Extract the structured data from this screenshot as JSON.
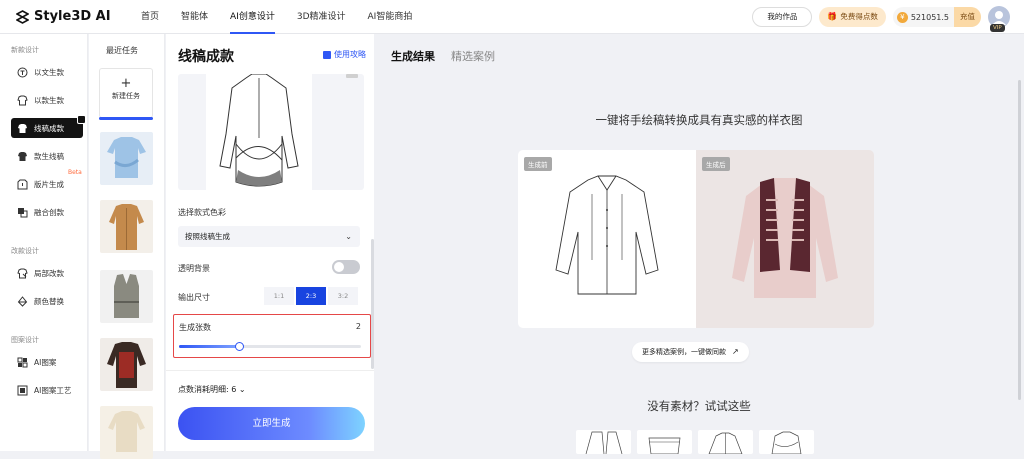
{
  "app": {
    "brand": "Style3D AI"
  },
  "nav": {
    "items": [
      "首页",
      "智能体",
      "AI创意设计",
      "3D精准设计",
      "AI智能商拍"
    ],
    "active_index": 2
  },
  "header": {
    "my_works": "我的作品",
    "free_points": "免费得点数",
    "points": "521051.5",
    "recharge": "充值",
    "vip": "VIP"
  },
  "sidebar": {
    "groups": [
      "新款设计",
      "改款设计",
      "图案设计"
    ],
    "items": [
      {
        "label": "以文生款",
        "icon": "text-shirt-icon"
      },
      {
        "label": "以款生款",
        "icon": "shirt-copy-icon"
      },
      {
        "label": "线稿成款",
        "icon": "sketch-shirt-icon",
        "active": true
      },
      {
        "label": "款生线稿",
        "icon": "shirt-to-sketch-icon"
      },
      {
        "label": "版片生成",
        "icon": "pattern-piece-icon",
        "badge": "Beta"
      },
      {
        "label": "融合创款",
        "icon": "merge-icon"
      },
      {
        "label": "局部改款",
        "icon": "partial-edit-icon"
      },
      {
        "label": "颜色替换",
        "icon": "color-replace-icon"
      },
      {
        "label": "AI图案",
        "icon": "ai-pattern-icon"
      },
      {
        "label": "AI图案工艺",
        "icon": "pattern-craft-icon"
      }
    ]
  },
  "recent": {
    "title": "最近任务",
    "new_task": "新建任务"
  },
  "panel": {
    "title": "线稿成款",
    "guide": "使用攻略",
    "color_label": "选择款式色彩",
    "color_value": "按照线稿生成",
    "transparent_label": "透明背景",
    "transparent_on": false,
    "size_label": "输出尺寸",
    "sizes": [
      "1:1",
      "2:3",
      "3:2"
    ],
    "size_active": 1,
    "count_label": "生成张数",
    "count_value": "2",
    "count_fraction": 0.33,
    "cost_label": "点数消耗明细: 6",
    "generate": "立即生成"
  },
  "main": {
    "tabs": [
      "生成结果",
      "精选案例"
    ],
    "headline": "一键将手绘稿转换成具有真实感的样衣图",
    "before_tag": "生成前",
    "after_tag": "生成后",
    "more_cases": "更多精选案例，一键做同款",
    "try_title": "没有素材？试试这些"
  },
  "colors": {
    "accent": "#2f57f5",
    "highlight_border": "#e54848",
    "active_nav": "#131313"
  }
}
